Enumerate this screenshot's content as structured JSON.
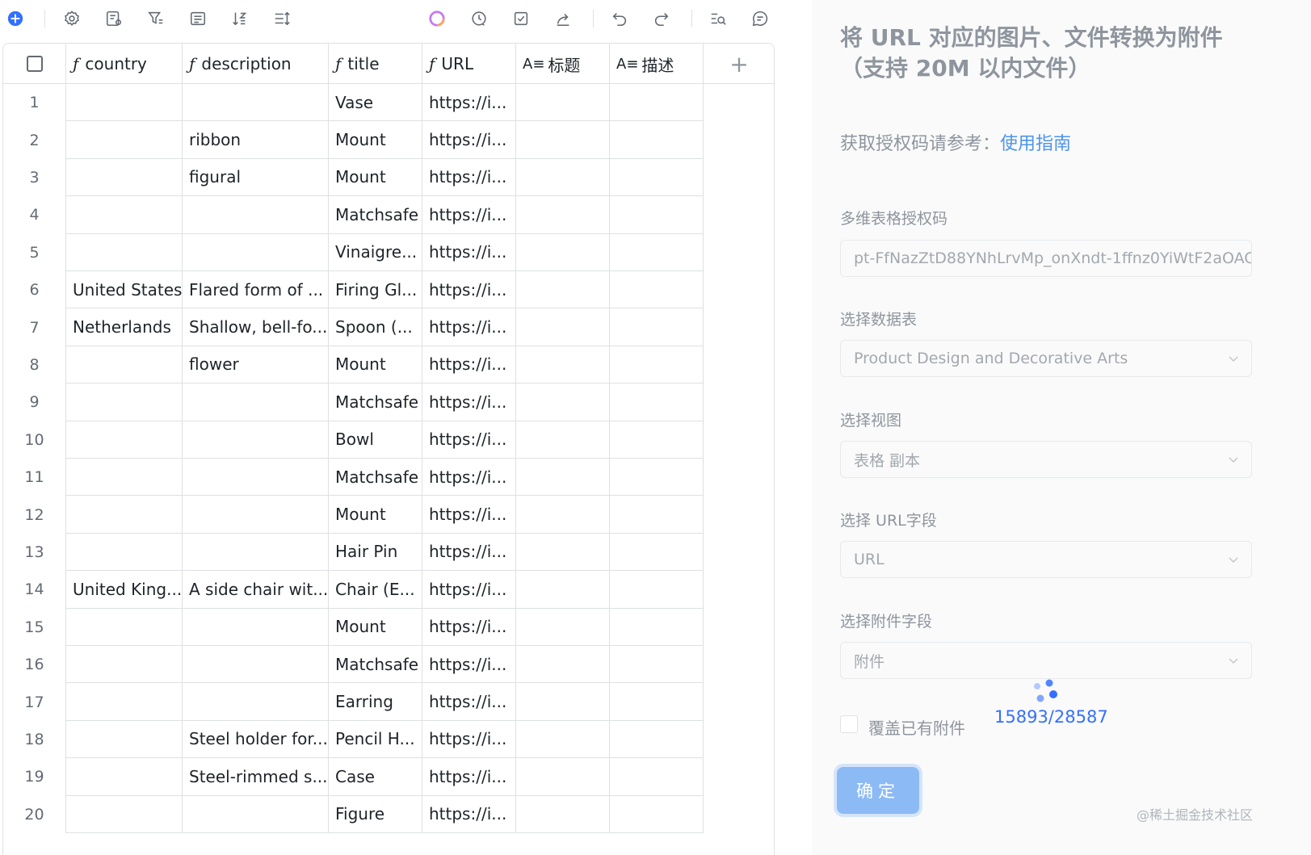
{
  "toolbar": {
    "icons": [
      "add-icon",
      "settings-icon",
      "form-icon",
      "filter-icon",
      "list-icon",
      "sort-icon",
      "row-height-icon",
      "ai-icon",
      "history-icon",
      "checklist-icon",
      "share-icon",
      "undo-icon",
      "redo-icon",
      "search-icon",
      "comment-icon"
    ]
  },
  "grid": {
    "columns": [
      {
        "label": "country",
        "type": "formula"
      },
      {
        "label": "description",
        "type": "formula"
      },
      {
        "label": "title",
        "type": "formula"
      },
      {
        "label": "URL",
        "type": "formula"
      },
      {
        "label": "标题",
        "type": "text"
      },
      {
        "label": "描述",
        "type": "text"
      }
    ],
    "rows": [
      {
        "num": "1",
        "country": "",
        "description": "",
        "title": "Vase",
        "url": "https://i...",
        "t": "",
        "d": ""
      },
      {
        "num": "2",
        "country": "",
        "description": "ribbon",
        "title": "Mount",
        "url": "https://i...",
        "t": "",
        "d": ""
      },
      {
        "num": "3",
        "country": "",
        "description": "figural",
        "title": "Mount",
        "url": "https://i...",
        "t": "",
        "d": ""
      },
      {
        "num": "4",
        "country": "",
        "description": "",
        "title": "Matchsafe",
        "url": "https://i...",
        "t": "",
        "d": ""
      },
      {
        "num": "5",
        "country": "",
        "description": "",
        "title": "Vinaigre...",
        "url": "https://i...",
        "t": "",
        "d": ""
      },
      {
        "num": "6",
        "country": "United States",
        "description": "Flared form of ...",
        "title": "Firing Gl...",
        "url": "https://i...",
        "t": "",
        "d": ""
      },
      {
        "num": "7",
        "country": "Netherlands",
        "description": "Shallow, bell-fo...",
        "title": "Spoon (...",
        "url": "https://i...",
        "t": "",
        "d": ""
      },
      {
        "num": "8",
        "country": "",
        "description": "flower",
        "title": "Mount",
        "url": "https://i...",
        "t": "",
        "d": ""
      },
      {
        "num": "9",
        "country": "",
        "description": "",
        "title": "Matchsafe",
        "url": "https://i...",
        "t": "",
        "d": ""
      },
      {
        "num": "10",
        "country": "",
        "description": "",
        "title": "Bowl",
        "url": "https://i...",
        "t": "",
        "d": ""
      },
      {
        "num": "11",
        "country": "",
        "description": "",
        "title": "Matchsafe",
        "url": "https://i...",
        "t": "",
        "d": ""
      },
      {
        "num": "12",
        "country": "",
        "description": "",
        "title": "Mount",
        "url": "https://i...",
        "t": "",
        "d": ""
      },
      {
        "num": "13",
        "country": "",
        "description": "",
        "title": "Hair Pin",
        "url": "https://i...",
        "t": "",
        "d": ""
      },
      {
        "num": "14",
        "country": "United King...",
        "description": "A side chair wit...",
        "title": "Chair (E...",
        "url": "https://i...",
        "t": "",
        "d": ""
      },
      {
        "num": "15",
        "country": "",
        "description": "",
        "title": "Mount",
        "url": "https://i...",
        "t": "",
        "d": ""
      },
      {
        "num": "16",
        "country": "",
        "description": "",
        "title": "Matchsafe",
        "url": "https://i...",
        "t": "",
        "d": ""
      },
      {
        "num": "17",
        "country": "",
        "description": "",
        "title": "Earring",
        "url": "https://i...",
        "t": "",
        "d": ""
      },
      {
        "num": "18",
        "country": "",
        "description": "Steel holder for...",
        "title": "Pencil H...",
        "url": "https://i...",
        "t": "",
        "d": ""
      },
      {
        "num": "19",
        "country": "",
        "description": "Steel-rimmed s...",
        "title": "Case",
        "url": "https://i...",
        "t": "",
        "d": ""
      },
      {
        "num": "20",
        "country": "",
        "description": "",
        "title": "Figure",
        "url": "https://i...",
        "t": "",
        "d": ""
      }
    ]
  },
  "panel": {
    "title": "将 URL 对应的图片、文件转换为附件（支持 20M 以内文件）",
    "guide_prefix": "获取授权码请参考：",
    "guide_link": "使用指南",
    "token_label": "多维表格授权码",
    "token_value": "pt-FfNazZtD88YNhLrvMp_onXndt-1ffnz0YiWtF2aOAC",
    "table_label": "选择数据表",
    "table_value": "Product Design and Decorative Arts",
    "view_label": "选择视图",
    "view_value": "表格 副本",
    "url_field_label": "选择 URL字段",
    "url_field_value": "URL",
    "attach_field_label": "选择附件字段",
    "attach_field_value": "附件",
    "progress": "15893/28587",
    "overwrite_label": "覆盖已有附件",
    "confirm_label": "确定",
    "watermark": "@稀土掘金技术社区"
  },
  "colors": {
    "accent": "#3370ff",
    "link": "#4e94e9",
    "button": "#8cbaf5",
    "border": "#dee0e3"
  }
}
